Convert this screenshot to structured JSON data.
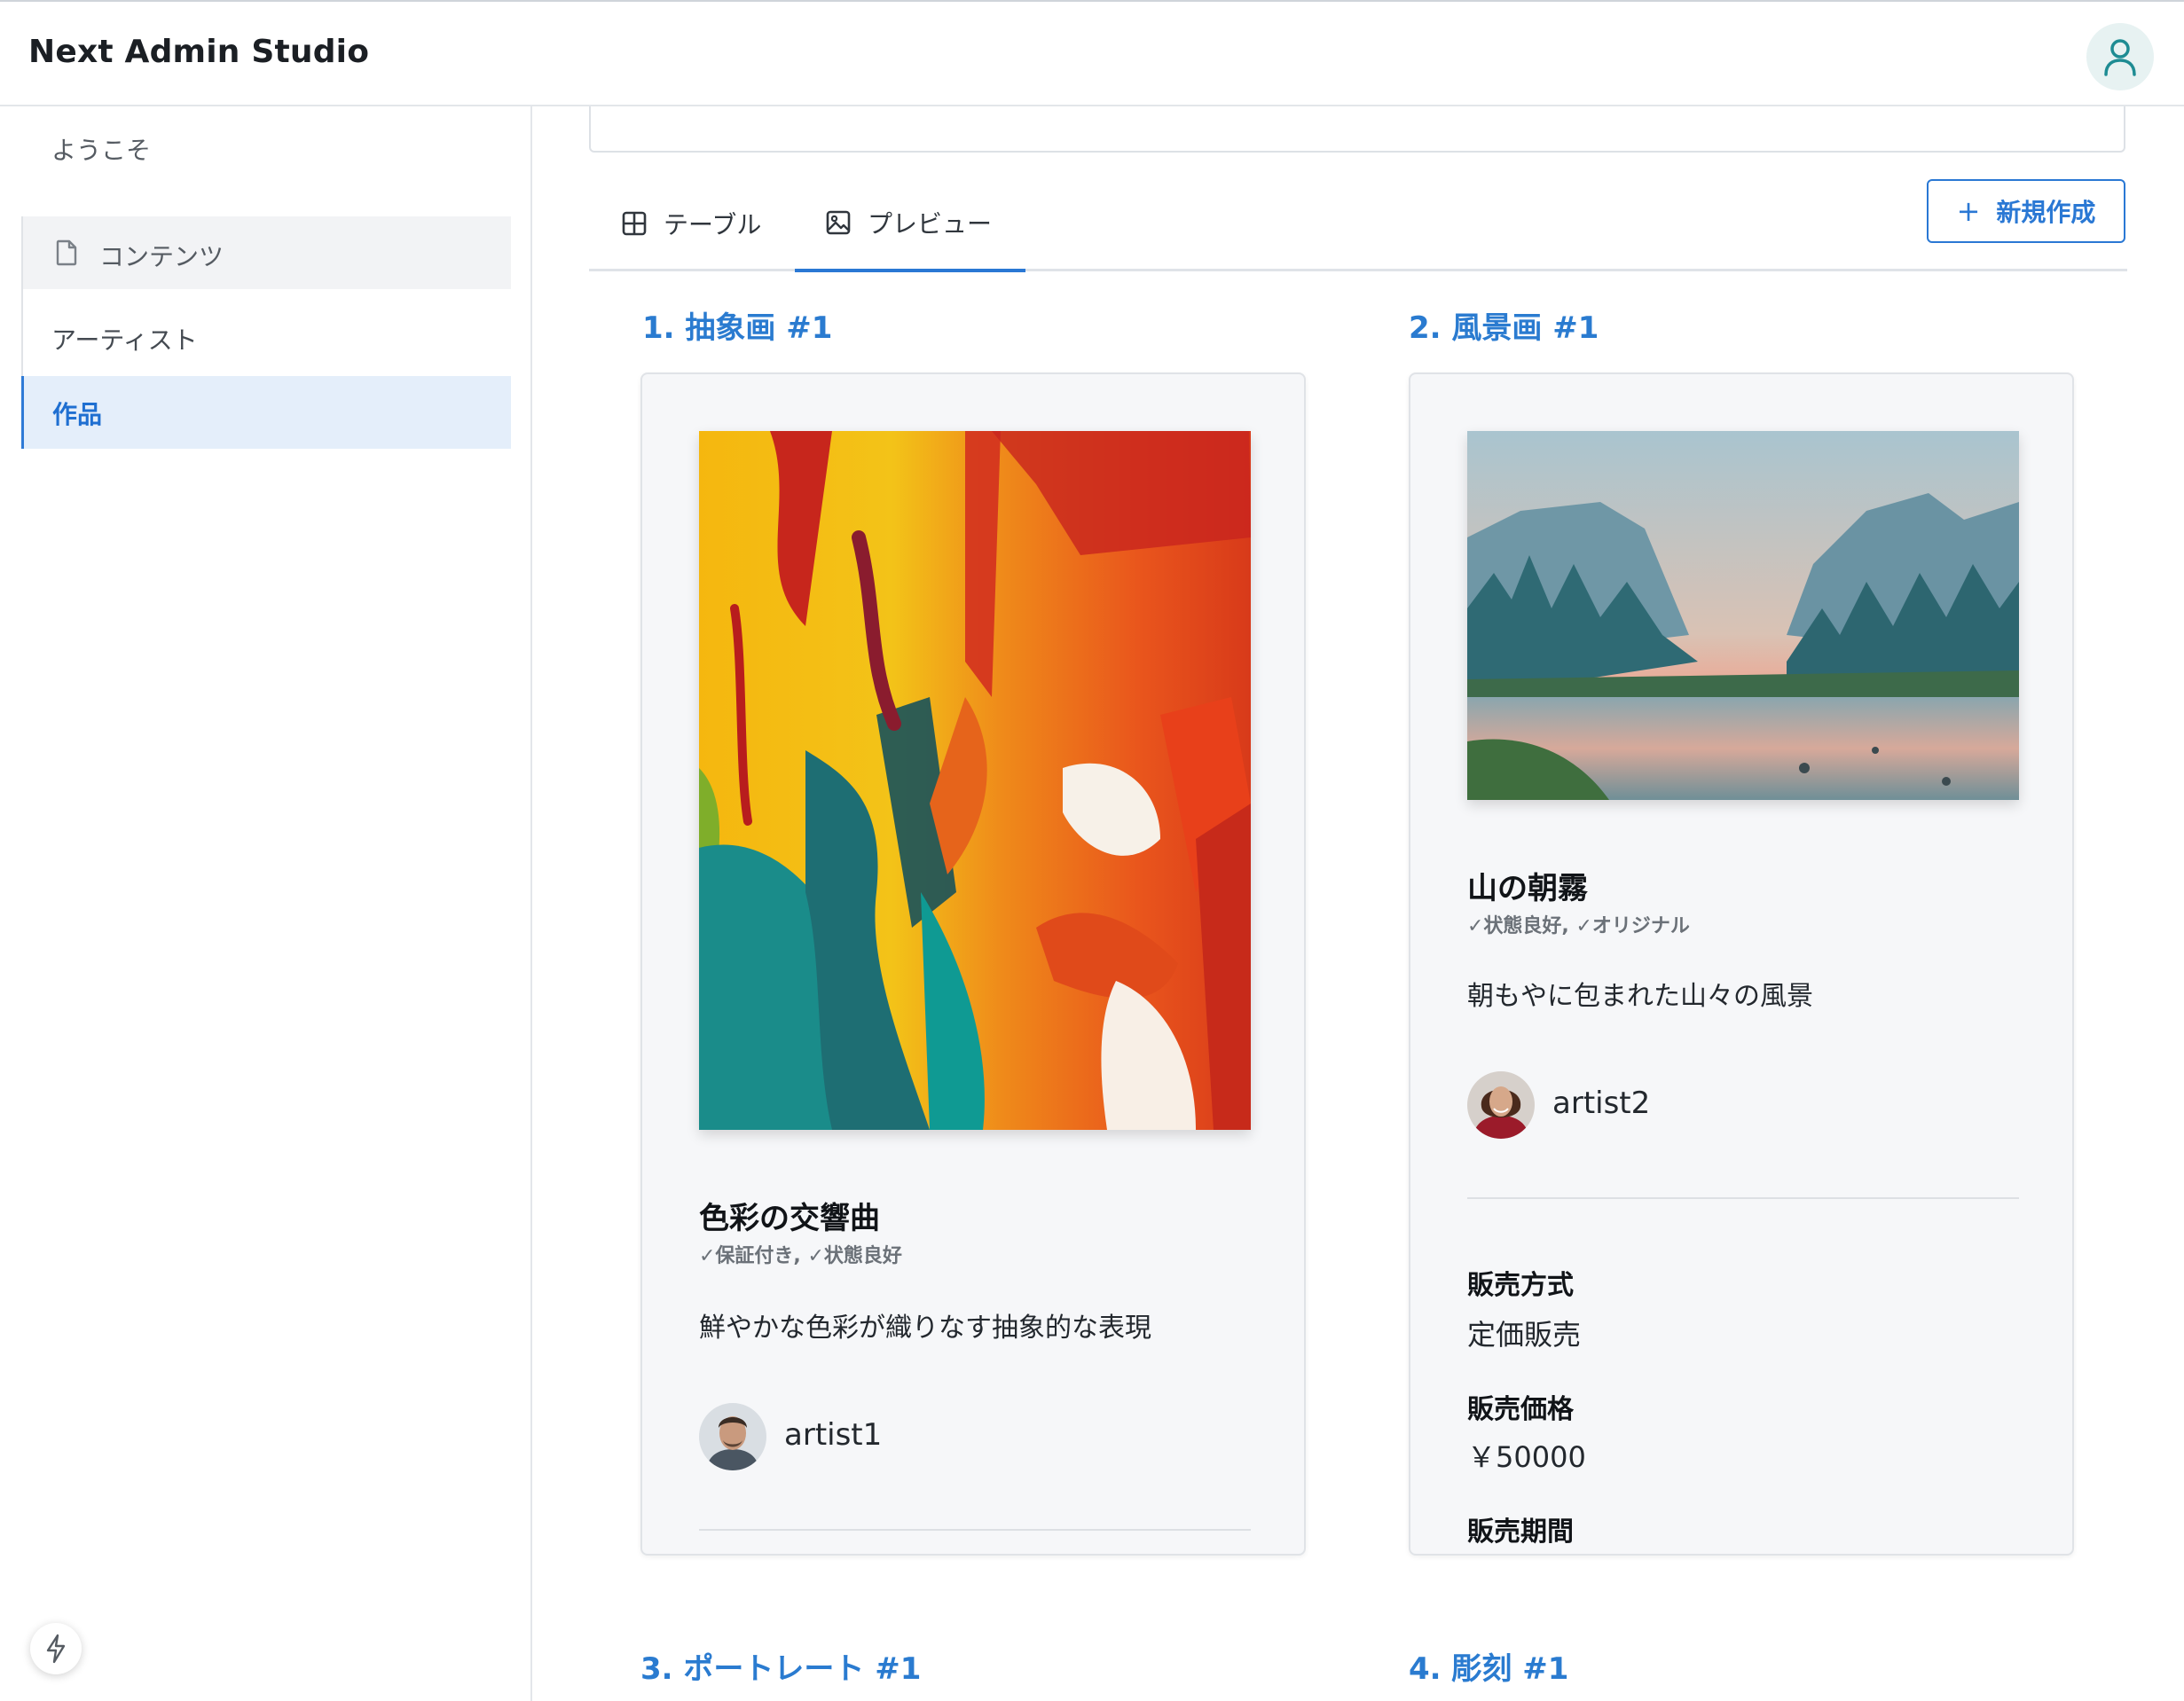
{
  "app": {
    "title": "Next Admin Studio"
  },
  "sidebar": {
    "welcome": "ようこそ",
    "group_label": "コンテンツ",
    "items": [
      {
        "label": "アーティスト",
        "active": false
      },
      {
        "label": "作品",
        "active": true
      }
    ]
  },
  "tabs": [
    {
      "label": "テーブル",
      "icon": "table-icon",
      "active": false
    },
    {
      "label": "プレビュー",
      "icon": "image-icon",
      "active": true
    }
  ],
  "toolbar": {
    "new_label": "新規作成",
    "new_icon": "plus-icon"
  },
  "sections": [
    {
      "title": "1. 抽象画 #1",
      "card": {
        "work_title": "色彩の交響曲",
        "tags": "✓保証付き, ✓状態良好",
        "description": "鮮やかな色彩が織りなす抽象的な表現",
        "artist": "artist1"
      }
    },
    {
      "title": "2. 風景画 #1",
      "card": {
        "work_title": "山の朝霧",
        "tags": "✓状態良好, ✓オリジナル",
        "description": "朝もやに包まれた山々の風景",
        "artist": "artist2",
        "fields": [
          {
            "label": "販売方式",
            "value": "定価販売"
          },
          {
            "label": "販売価格",
            "value": "￥50000"
          },
          {
            "label": "販売期間",
            "value": ""
          }
        ]
      }
    },
    {
      "title": "3. ポートレート #1"
    },
    {
      "title": "4. 彫刻 #1"
    }
  ],
  "colors": {
    "accent": "#2a78d4",
    "section_title": "#2a7bd0",
    "active_nav_bg": "#e4eefa"
  }
}
